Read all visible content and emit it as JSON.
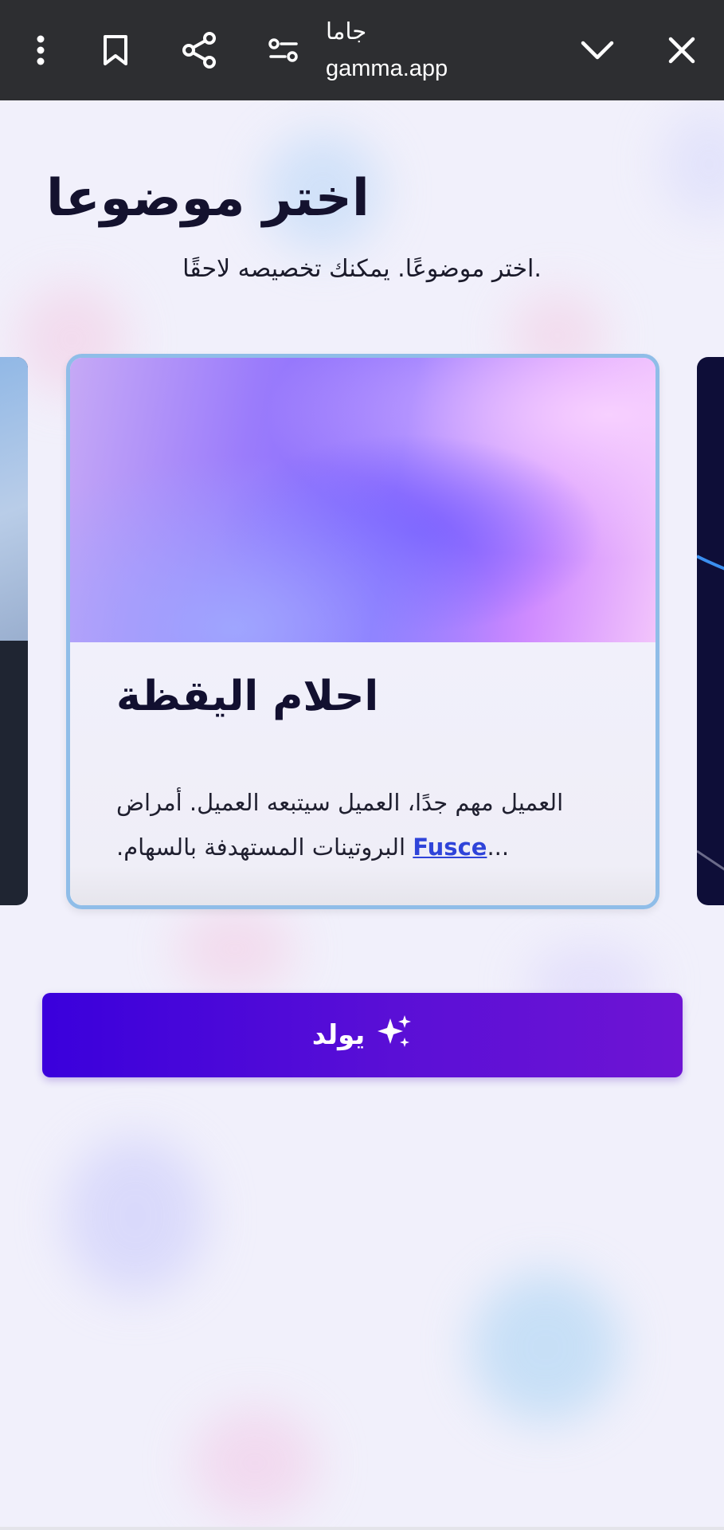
{
  "browser": {
    "title": "جاما",
    "url": "gamma.app",
    "icons": {
      "menu": "more-vertical-icon",
      "bookmark": "bookmark-icon",
      "share": "share-icon",
      "settings": "tune-icon",
      "collapse": "chevron-down-icon",
      "close": "close-icon"
    }
  },
  "page": {
    "title": "اختر موضوعا",
    "subtitle": "اختر موضوعًا. يمكنك تخصيصه لاحقًا."
  },
  "theme_card": {
    "name": "احلام اليقظة",
    "description_line1": "العميل مهم جدًا، العميل سيتبعه العميل. أمراض",
    "description_line2_prefix": "البروتينات المستهدفة بالسهام.",
    "description_link": "Fusce",
    "description_ellipsis": "...",
    "border_color": "#8fbde8"
  },
  "generate_button": {
    "label": "يولد",
    "icon": "sparkles-icon",
    "colors": [
      "#3a00dc",
      "#6e14d4"
    ]
  }
}
